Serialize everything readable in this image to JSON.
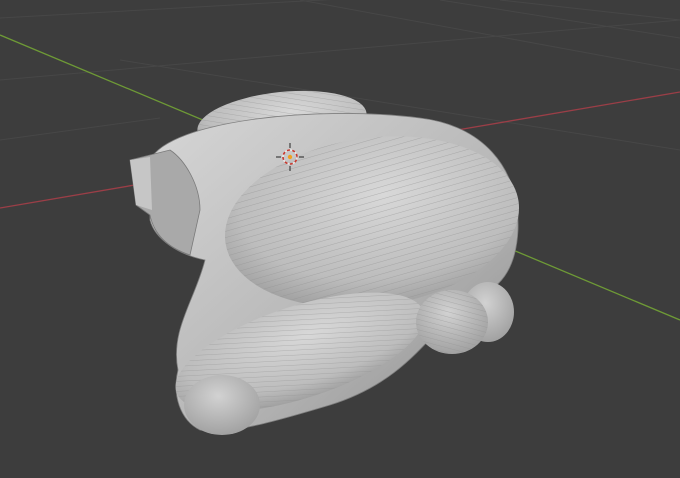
{
  "viewport": {
    "background": "#3d3d3d",
    "grid_color": "#474747",
    "x_axis_color": "#9b3e47",
    "y_axis_color": "#6e9a36",
    "object_shading": "#b4b4b4"
  },
  "scene": {
    "object_icon": "sculpted-mesh",
    "cursor_icon": "3d-cursor-icon"
  }
}
